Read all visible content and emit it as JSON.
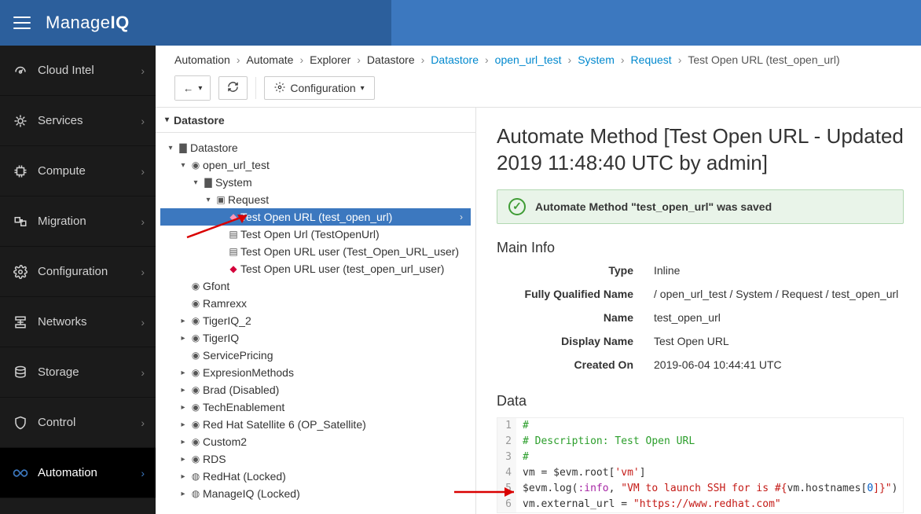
{
  "brand": {
    "prefix": "Manage",
    "suffix": "IQ"
  },
  "sidebar": {
    "items": [
      {
        "label": "Cloud Intel"
      },
      {
        "label": "Services"
      },
      {
        "label": "Compute"
      },
      {
        "label": "Migration"
      },
      {
        "label": "Configuration"
      },
      {
        "label": "Networks"
      },
      {
        "label": "Storage"
      },
      {
        "label": "Control"
      },
      {
        "label": "Automation"
      }
    ]
  },
  "breadcrumb": {
    "p0": "Automation",
    "p1": "Automate",
    "p2": "Explorer",
    "p3": "Datastore",
    "p4": "Datastore",
    "p5": "open_url_test",
    "p6": "System",
    "p7": "Request",
    "p8": "Test Open URL (test_open_url)"
  },
  "toolbar": {
    "config_label": "Configuration"
  },
  "tree": {
    "header": "Datastore",
    "root": "Datastore",
    "n_open_url_test": "open_url_test",
    "n_system": "System",
    "n_request": "Request",
    "leaf_selected": "Test Open URL (test_open_url)",
    "leaf2": "Test Open Url (TestOpenUrl)",
    "leaf3": "Test Open URL user (Test_Open_URL_user)",
    "leaf4": "Test Open URL user (test_open_url_user)",
    "gfont": "Gfont",
    "ramrexx": "Ramrexx",
    "tigeriq2": "TigerIQ_2",
    "tigeriq": "TigerIQ",
    "sp": "ServicePricing",
    "em": "ExpresionMethods",
    "brad": "Brad (Disabled)",
    "te": "TechEnablement",
    "rhs": "Red Hat Satellite 6 (OP_Satellite)",
    "c2": "Custom2",
    "rds": "RDS",
    "rh": "RedHat (Locked)",
    "miq": "ManageIQ (Locked)"
  },
  "detail": {
    "title": "Automate Method [Test Open URL - Updated 2019 11:48:40 UTC by admin]",
    "alert": "Automate Method \"test_open_url\" was saved",
    "section_main": "Main Info",
    "kv": {
      "type_k": "Type",
      "type_v": "Inline",
      "fqn_k": "Fully Qualified Name",
      "fqn_v": "/ open_url_test / System / Request / test_open_url",
      "name_k": "Name",
      "name_v": "test_open_url",
      "dn_k": "Display Name",
      "dn_v": "Test Open URL",
      "created_k": "Created On",
      "created_v": "2019-06-04 10:44:41 UTC"
    },
    "section_data": "Data",
    "code": {
      "l1": "#",
      "l2": "# Description: Test Open URL",
      "l3": "#",
      "l4_vm": "vm",
      "l4_eq": " = ",
      "l4_evm": "$evm",
      "l4_root": ".root[",
      "l4_key": "'vm'",
      "l4_close": "]",
      "l5_evm": "$evm",
      "l5_log": ".log(",
      "l5_sym": ":info",
      "l5_comma": ", ",
      "l5_str_a": "\"VM to launch SSH for is #{",
      "l5_hn": "vm.hostnames[",
      "l5_zero": "0",
      "l5_str_b": "]}\"",
      "l5_close": ")",
      "l6_lhs": "vm.external_url = ",
      "l6_url": "\"https://www.redhat.com\""
    }
  }
}
